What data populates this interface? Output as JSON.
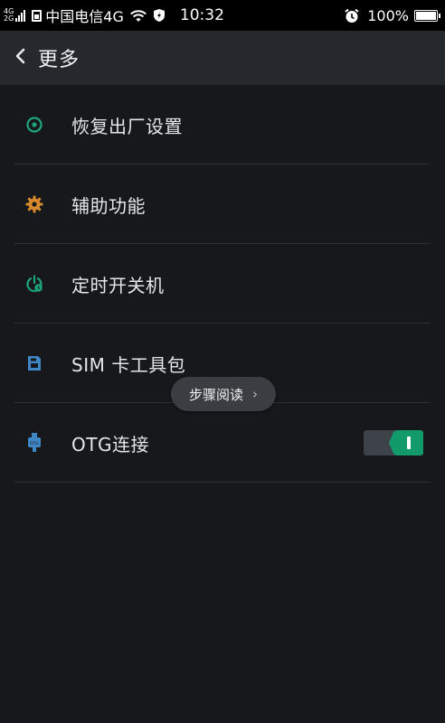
{
  "status_bar": {
    "net_top": "4G",
    "net_bottom": "2G",
    "carrier": "中国电信4G",
    "time": "10:32",
    "battery": "100%",
    "icons": [
      "signal-icon",
      "sim-icon",
      "wifi-icon",
      "shield-icon",
      "alarm-icon",
      "battery-icon"
    ]
  },
  "header": {
    "back_icon": "chevron-left-icon",
    "title": "更多"
  },
  "menu": {
    "items": [
      {
        "label": "恢复出厂设置",
        "icon": "reset-icon",
        "icon_color": "#1ea57a"
      },
      {
        "label": "辅助功能",
        "icon": "gear-icon",
        "icon_color": "#d98a2b"
      },
      {
        "label": "定时开关机",
        "icon": "timer-power-icon",
        "icon_color": "#1ea57a"
      },
      {
        "label": "SIM 卡工具包",
        "icon": "sim-card-icon",
        "icon_color": "#3f86c6"
      },
      {
        "label": "OTG连接",
        "icon": "usb-otg-icon",
        "icon_color": "#3f86c6",
        "toggle_on": true
      }
    ]
  },
  "floating": {
    "step_reading": "步骤阅读",
    "chevron": "›"
  },
  "colors": {
    "background": "#16181c",
    "header": "#25292e",
    "accent_green": "#139a6a"
  }
}
